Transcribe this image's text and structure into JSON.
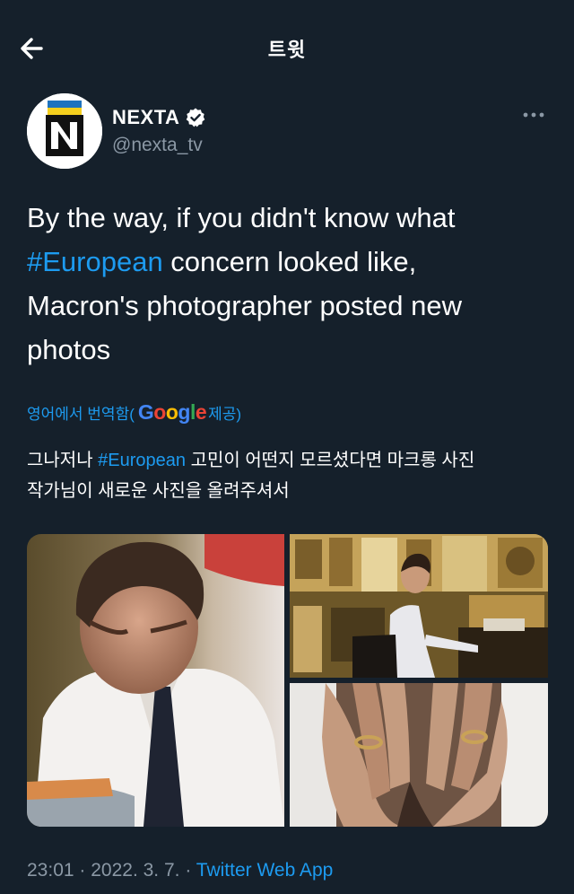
{
  "header": {
    "title": "트윗",
    "back_icon": "arrow-left-icon"
  },
  "author": {
    "name": "NEXTA",
    "handle": "@nexta_tv",
    "verified": true,
    "avatar_letter": "N",
    "more_icon": "ellipsis-icon"
  },
  "tweet": {
    "line1": "By the way, if you didn't know what",
    "hashtag": "#European",
    "line2_rest": " concern looked like,",
    "line3": "Macron's photographer posted new",
    "line4": "photos"
  },
  "translation": {
    "prefix": "영어에서 번역함(",
    "google": [
      "G",
      "o",
      "o",
      "g",
      "l",
      "e"
    ],
    "suffix": " 제공)"
  },
  "translated_text": {
    "part1": "그나저나 ",
    "hashtag": "#European",
    "part2": " 고민이 어떤지 모르셨다면 마크롱 사진",
    "line2": "작가님이 새로운 사진을 올려주셔서"
  },
  "meta": {
    "time": "23:01",
    "sep1": " · ",
    "date": "2022. 3. 7.",
    "sep2": " · ",
    "app": "Twitter Web App"
  },
  "colors": {
    "background": "#15202b",
    "accent": "#1d9bf0",
    "secondary_text": "#8b98a5"
  }
}
